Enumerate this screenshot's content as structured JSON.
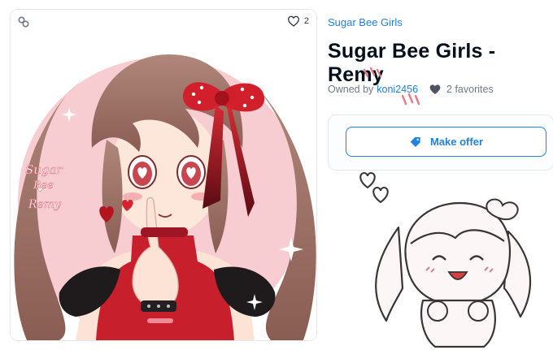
{
  "card": {
    "favorite_count": "2",
    "icons": {
      "chain": "chain-link-icon",
      "favorite": "heart-outline-icon"
    },
    "artwork": {
      "signature_text": [
        "Sugar",
        "Bee",
        "Remy"
      ],
      "alt": "Sugar Bee Girls - Remy"
    }
  },
  "details": {
    "collection_name": "Sugar Bee Girls",
    "title": "Sugar Bee Girls - Remy",
    "owned_by_label": "Owned by",
    "owner_name": "koni2456",
    "favorites_text": "2 favorites",
    "favorites_icon": "heart-filled-icon"
  },
  "offer": {
    "button_label": "Make offer",
    "icon": "price-tag-icon"
  },
  "colors": {
    "accent": "#2081e2",
    "title": "#04111d",
    "muted": "#707a83",
    "border": "#e5e8eb",
    "art_bg": "#f8cdd2",
    "dress_red": "#c81f2c"
  }
}
